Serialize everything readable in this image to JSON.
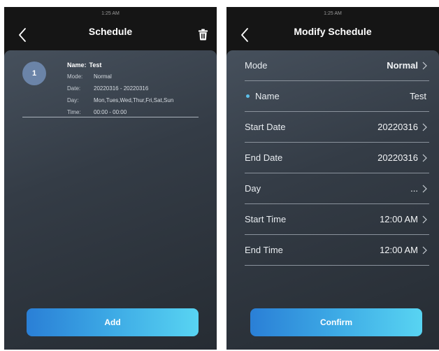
{
  "schedule_screen": {
    "status_time": "1:25 AM",
    "title": "Schedule",
    "entry": {
      "index": "1",
      "name_label": "Name:",
      "name": "Test",
      "mode_label": "Mode:",
      "mode": "Normal",
      "date_label": "Date:",
      "date": "20220316 - 20220316",
      "day_label": "Day:",
      "day": "Mon,Tues,Wed,Thur,Fri,Sat,Sun",
      "time_label": "Time:",
      "time": "00:00 - 00:00"
    },
    "add_button": "Add"
  },
  "modify_screen": {
    "status_time": "1:25 AM",
    "title": "Modify Schedule",
    "fields": {
      "mode": {
        "label": "Mode",
        "value": "Normal"
      },
      "name": {
        "label": "Name",
        "value": "Test"
      },
      "start_date": {
        "label": "Start Date",
        "value": "20220316"
      },
      "end_date": {
        "label": "End Date",
        "value": "20220316"
      },
      "day": {
        "label": "Day",
        "value": "..."
      },
      "start_time": {
        "label": "Start Time",
        "value": "12:00 AM"
      },
      "end_time": {
        "label": "End Time",
        "value": "12:00 AM"
      }
    },
    "confirm_button": "Confirm"
  },
  "icons": {
    "back": "chevron-left-icon",
    "delete": "trash-icon",
    "row_arrow": "chevron-right-icon",
    "required": "required-dot-icon"
  },
  "colors": {
    "accent_start": "#2a7fd6",
    "accent_end": "#58d4f2",
    "badge": "#6b84a8",
    "required_dot": "#5cc0ea"
  }
}
